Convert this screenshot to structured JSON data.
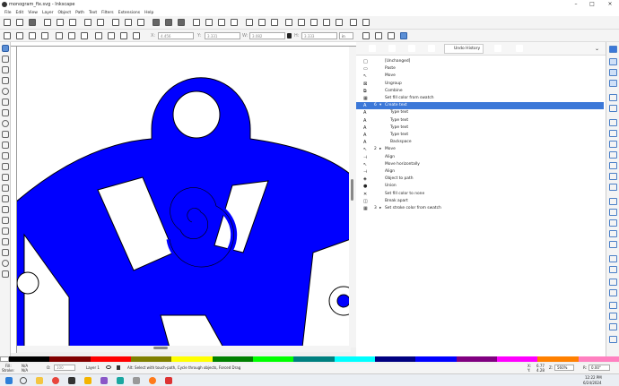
{
  "window": {
    "title": "monogram_fix.svg - Inkscape"
  },
  "menu": [
    "File",
    "Edit",
    "View",
    "Layer",
    "Object",
    "Path",
    "Text",
    "Filters",
    "Extensions",
    "Help"
  ],
  "controls": {
    "x_label": "X:",
    "x_value": "4.456",
    "y_label": "Y:",
    "y_value": "3.331",
    "w_label": "W:",
    "w_value": "3.082",
    "h_label": "H:",
    "h_value": "3.333",
    "unit": "in"
  },
  "dock": {
    "active_tab": "Undo History",
    "history": [
      {
        "label": "[Unchanged]",
        "icon": "unchanged-icon"
      },
      {
        "label": "Paste",
        "icon": "paste-icon"
      },
      {
        "label": "Move",
        "icon": "move-icon"
      },
      {
        "label": "Ungroup",
        "icon": "ungroup-icon"
      },
      {
        "label": "Combine",
        "icon": "combine-icon"
      },
      {
        "label": "Set fill color from swatch",
        "icon": "swatch-icon"
      },
      {
        "label": "Create text",
        "icon": "text-icon",
        "count": "6",
        "expanded": true,
        "selected": true
      },
      {
        "label": "Type text",
        "icon": "text-icon",
        "child": true
      },
      {
        "label": "Type text",
        "icon": "text-icon",
        "child": true
      },
      {
        "label": "Type text",
        "icon": "text-icon",
        "child": true
      },
      {
        "label": "Type text",
        "icon": "text-icon",
        "child": true
      },
      {
        "label": "Backspace",
        "icon": "text-icon",
        "child": true
      },
      {
        "label": "Move",
        "icon": "move-icon",
        "count": "2",
        "collapsed": true
      },
      {
        "label": "Align",
        "icon": "align-icon"
      },
      {
        "label": "Move horizontally",
        "icon": "move-icon"
      },
      {
        "label": "Align",
        "icon": "align-icon"
      },
      {
        "label": "Object to path",
        "icon": "object-to-path-icon"
      },
      {
        "label": "Union",
        "icon": "union-icon"
      },
      {
        "label": "Set fill color to none",
        "icon": "fill-none-icon"
      },
      {
        "label": "Break apart",
        "icon": "break-apart-icon"
      },
      {
        "label": "Set stroke color from swatch",
        "icon": "swatch-icon",
        "count": "3",
        "collapsed": true
      }
    ]
  },
  "status": {
    "fill_label": "Fill:",
    "fill_value": "N/A",
    "stroke_label": "Stroke:",
    "stroke_value": "N/A",
    "opacity_label": "O:",
    "opacity_value": "100",
    "layer": "Layer 1",
    "message": "Alt: Select with touch-path, Cycle through objects, Forced Drag",
    "x_label": "X:",
    "x_value": "6.77",
    "y_label": "Y:",
    "y_value": "4.28",
    "zoom_label": "Z:",
    "zoom_value": "560%",
    "rot_label": "R:",
    "rot_value": "0.00°"
  },
  "taskbar": {
    "time": "12:22 PM",
    "date": "6/24/2024"
  },
  "colors": {
    "shape_fill": "#0000ff",
    "selection": "#3c78d8",
    "palette": [
      "#000000",
      "#800000",
      "#ff0000",
      "#808000",
      "#ffff00",
      "#008000",
      "#00ff00",
      "#008080",
      "#00ffff",
      "#000080",
      "#0000ff",
      "#800080",
      "#ff00ff",
      "#ff8000",
      "#ff80c0"
    ]
  }
}
